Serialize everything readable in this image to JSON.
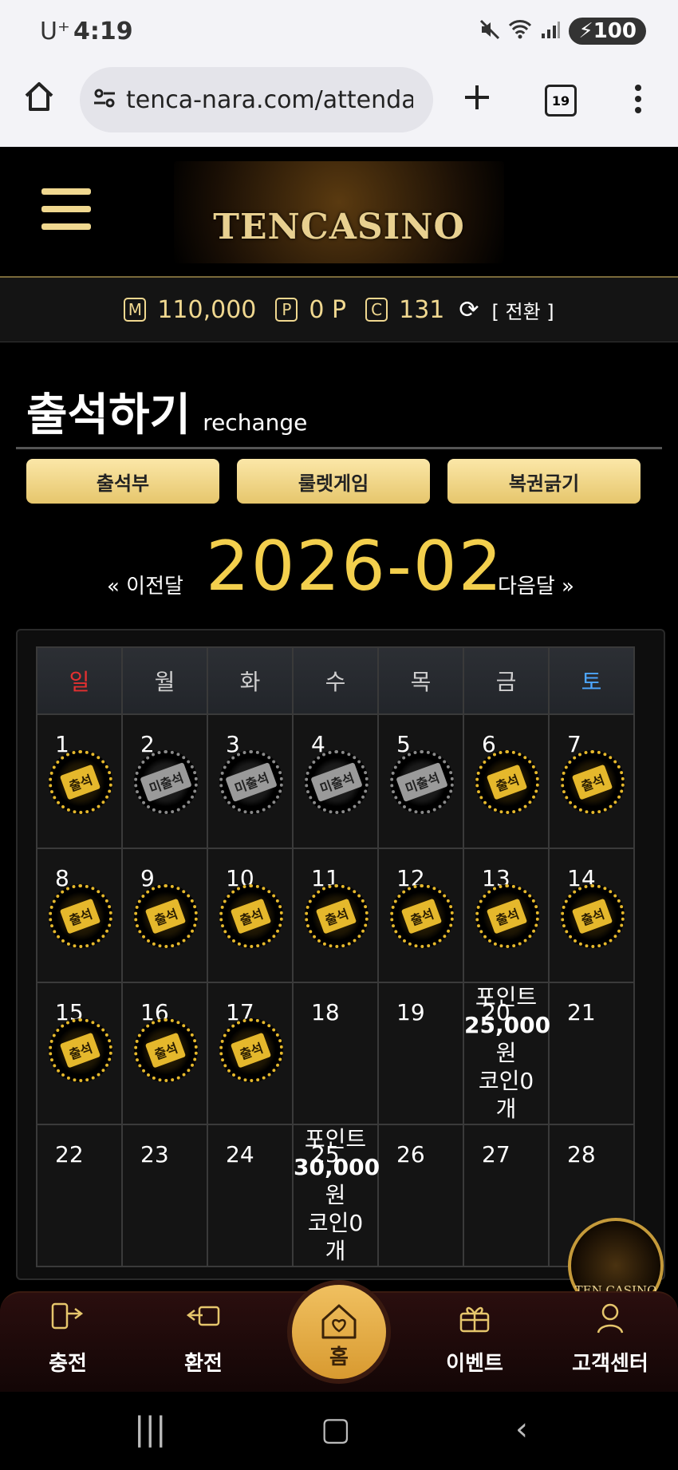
{
  "status_bar": {
    "carrier": "U⁺",
    "time": "4:19",
    "battery": "100"
  },
  "browser": {
    "url": "tenca-nara.com/attenda",
    "tab_count": "19"
  },
  "site": {
    "logo_text": "TENCASINO"
  },
  "balance": {
    "money_icon": "M",
    "money": "110,000",
    "point_icon": "P",
    "point": "0 P",
    "coin_icon": "C",
    "coin": "131",
    "swap_label": "[ 전환 ]"
  },
  "page": {
    "title": "출석하기",
    "subtitle": "rechange"
  },
  "buttons": [
    "출석부",
    "룰렛게임",
    "복권긁기"
  ],
  "calendar": {
    "prev_label": "« 이전달",
    "next_label": "다음달 »",
    "month": "2026-02",
    "weekdays": [
      "일",
      "월",
      "화",
      "수",
      "목",
      "금",
      "토"
    ],
    "weekday_colors": [
      "#e53030",
      "#cfcfcf",
      "#cfcfcf",
      "#cfcfcf",
      "#cfcfcf",
      "#cfcfcf",
      "#4da6ff"
    ],
    "stamp_attended": "출석",
    "stamp_absent": "미출석",
    "weeks": [
      [
        {
          "day": "1",
          "status": "attended"
        },
        {
          "day": "2",
          "status": "absent"
        },
        {
          "day": "3",
          "status": "absent"
        },
        {
          "day": "4",
          "status": "absent"
        },
        {
          "day": "5",
          "status": "absent"
        },
        {
          "day": "6",
          "status": "attended"
        },
        {
          "day": "7",
          "status": "attended"
        }
      ],
      [
        {
          "day": "8",
          "status": "attended"
        },
        {
          "day": "9",
          "status": "attended"
        },
        {
          "day": "10",
          "status": "attended"
        },
        {
          "day": "11",
          "status": "attended"
        },
        {
          "day": "12",
          "status": "attended"
        },
        {
          "day": "13",
          "status": "attended"
        },
        {
          "day": "14",
          "status": "attended"
        }
      ],
      [
        {
          "day": "15",
          "status": "attended"
        },
        {
          "day": "16",
          "status": "attended"
        },
        {
          "day": "17",
          "status": "attended"
        },
        {
          "day": "18",
          "status": "none"
        },
        {
          "day": "19",
          "status": "none"
        },
        {
          "day": "20",
          "status": "none",
          "reward": [
            "포인트",
            "25,000",
            "원",
            "코인0",
            "개"
          ]
        },
        {
          "day": "21",
          "status": "none"
        }
      ],
      [
        {
          "day": "22",
          "status": "none"
        },
        {
          "day": "23",
          "status": "none"
        },
        {
          "day": "24",
          "status": "none"
        },
        {
          "day": "25",
          "status": "none",
          "reward": [
            "포인트",
            "30,000",
            "원",
            "코인0",
            "개"
          ]
        },
        {
          "day": "26",
          "status": "none"
        },
        {
          "day": "27",
          "status": "none"
        },
        {
          "day": "28",
          "status": "none"
        }
      ]
    ]
  },
  "fab": {
    "label": "TEN CASINO"
  },
  "bottom_nav": [
    {
      "label": "충전",
      "icon": "charge-icon"
    },
    {
      "label": "환전",
      "icon": "exchange-icon"
    },
    {
      "label": "홈",
      "icon": "home-icon"
    },
    {
      "label": "이벤트",
      "icon": "gift-icon"
    },
    {
      "label": "고객센터",
      "icon": "support-icon"
    }
  ]
}
